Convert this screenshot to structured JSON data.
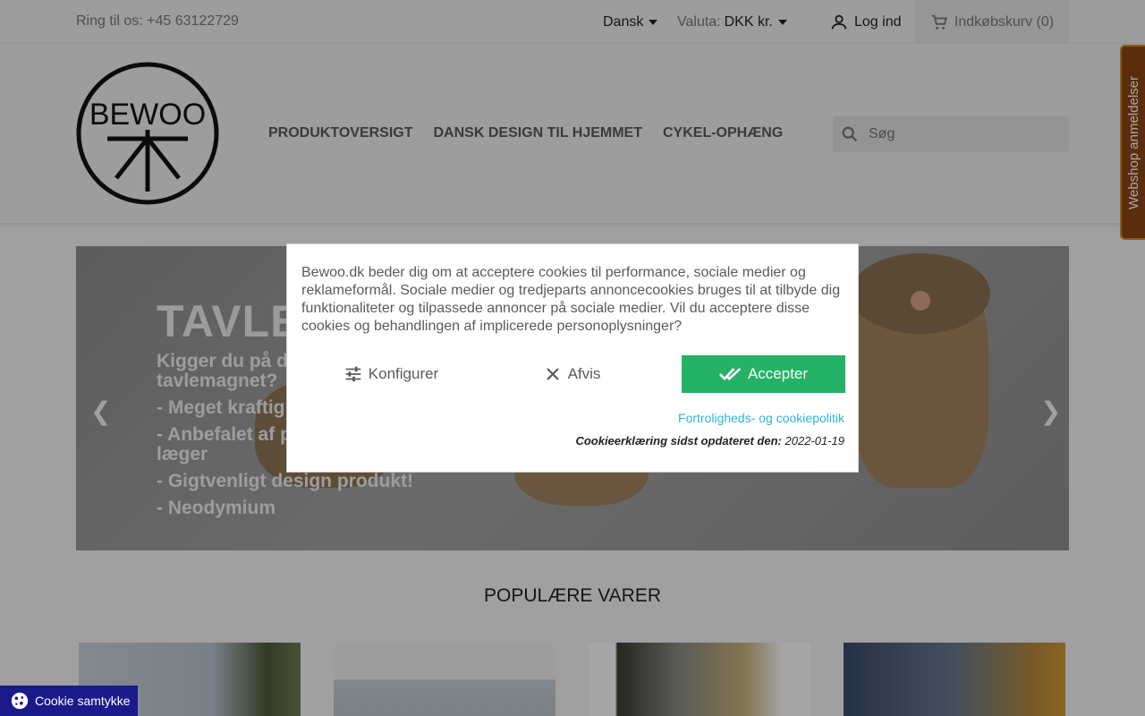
{
  "topbar": {
    "phone": "Ring til os: +45 63122729",
    "language": "Dansk",
    "currency_label": "Valuta:",
    "currency_value": "DKK kr.",
    "login": "Log ind",
    "cart": "Indkøbskurv (0)"
  },
  "header": {
    "logo_text": "BEWOO",
    "nav": [
      "PRODUKTOVERSIGT",
      "DANSK DESIGN TIL HJEMMET",
      "CYKEL-OPHÆNG"
    ],
    "search_placeholder": "Søg"
  },
  "reviews_tab": "Webshop anmeldelser",
  "slider": {
    "title": "TAVLE",
    "lines": [
      "Kigger du på di",
      "tavlemagnet?",
      "- Meget kraftig",
      "- Anbefalet af p",
      "læger",
      "- Gigtvenligt design produkt!",
      "- Neodymium"
    ]
  },
  "cookie_modal": {
    "text": "Bewoo.dk beder dig om at acceptere cookies til performance, sociale medier og reklameformål. Sociale medier og tredjeparts annoncecookies bruges til at tilbyde dig funktionaliteter og tilpassede annoncer på sociale medier. Vil du acceptere disse cookies og behandlingen af implicerede personoplysninger?",
    "configure": "Konfigurer",
    "reject": "Afvis",
    "accept": "Accepter",
    "privacy_link": "Fortroligheds- og cookiepolitik",
    "updated_label": "Cookieerklæring sidst opdateret den:",
    "updated_date": "2022-01-19"
  },
  "popular_title": "POPULÆRE VARER",
  "cookie_badge": "Cookie samtykke",
  "colors": {
    "accent_green": "#24b267",
    "link_blue": "#2fb5d2",
    "badge_blue": "#1a1a8a",
    "reviews_brown": "#8b4513"
  }
}
